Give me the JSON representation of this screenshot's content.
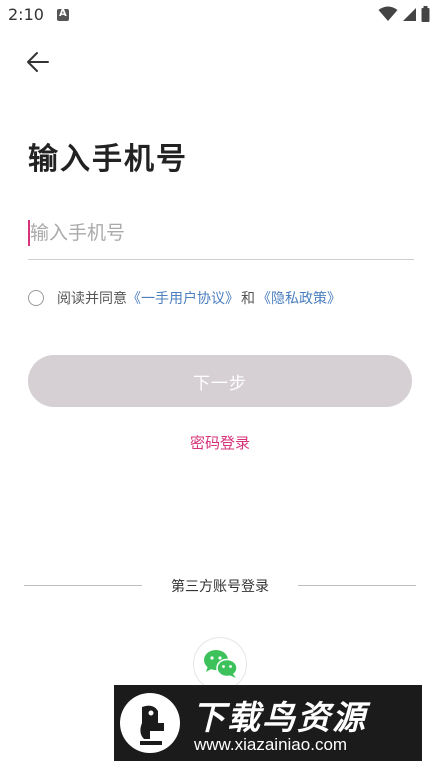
{
  "status_bar": {
    "time": "2:10",
    "icons": [
      "notification-a-icon",
      "wifi-icon",
      "cell-signal-icon",
      "battery-icon"
    ]
  },
  "header": {
    "back_icon": "arrow-left-icon",
    "title": "输入手机号"
  },
  "phone_input": {
    "value": "",
    "placeholder": "输入手机号"
  },
  "agreement": {
    "checked": false,
    "prefix": "阅读并同意",
    "user_agreement_link": "《一手用户协议》",
    "conjunction": "和",
    "privacy_policy_link": "《隐私政策》"
  },
  "actions": {
    "next_label": "下一步",
    "password_login_label": "密码登录"
  },
  "third_party": {
    "label": "第三方账号登录",
    "providers": [
      {
        "icon": "wechat-icon"
      }
    ]
  },
  "watermark": {
    "title": "下载鸟资源",
    "url": "www.xiazainiao.com"
  },
  "colors": {
    "accent": "#d6337a",
    "link": "#4b7fbf",
    "button_disabled": "#d6d0d4",
    "wechat_green": "#3dc15a"
  }
}
